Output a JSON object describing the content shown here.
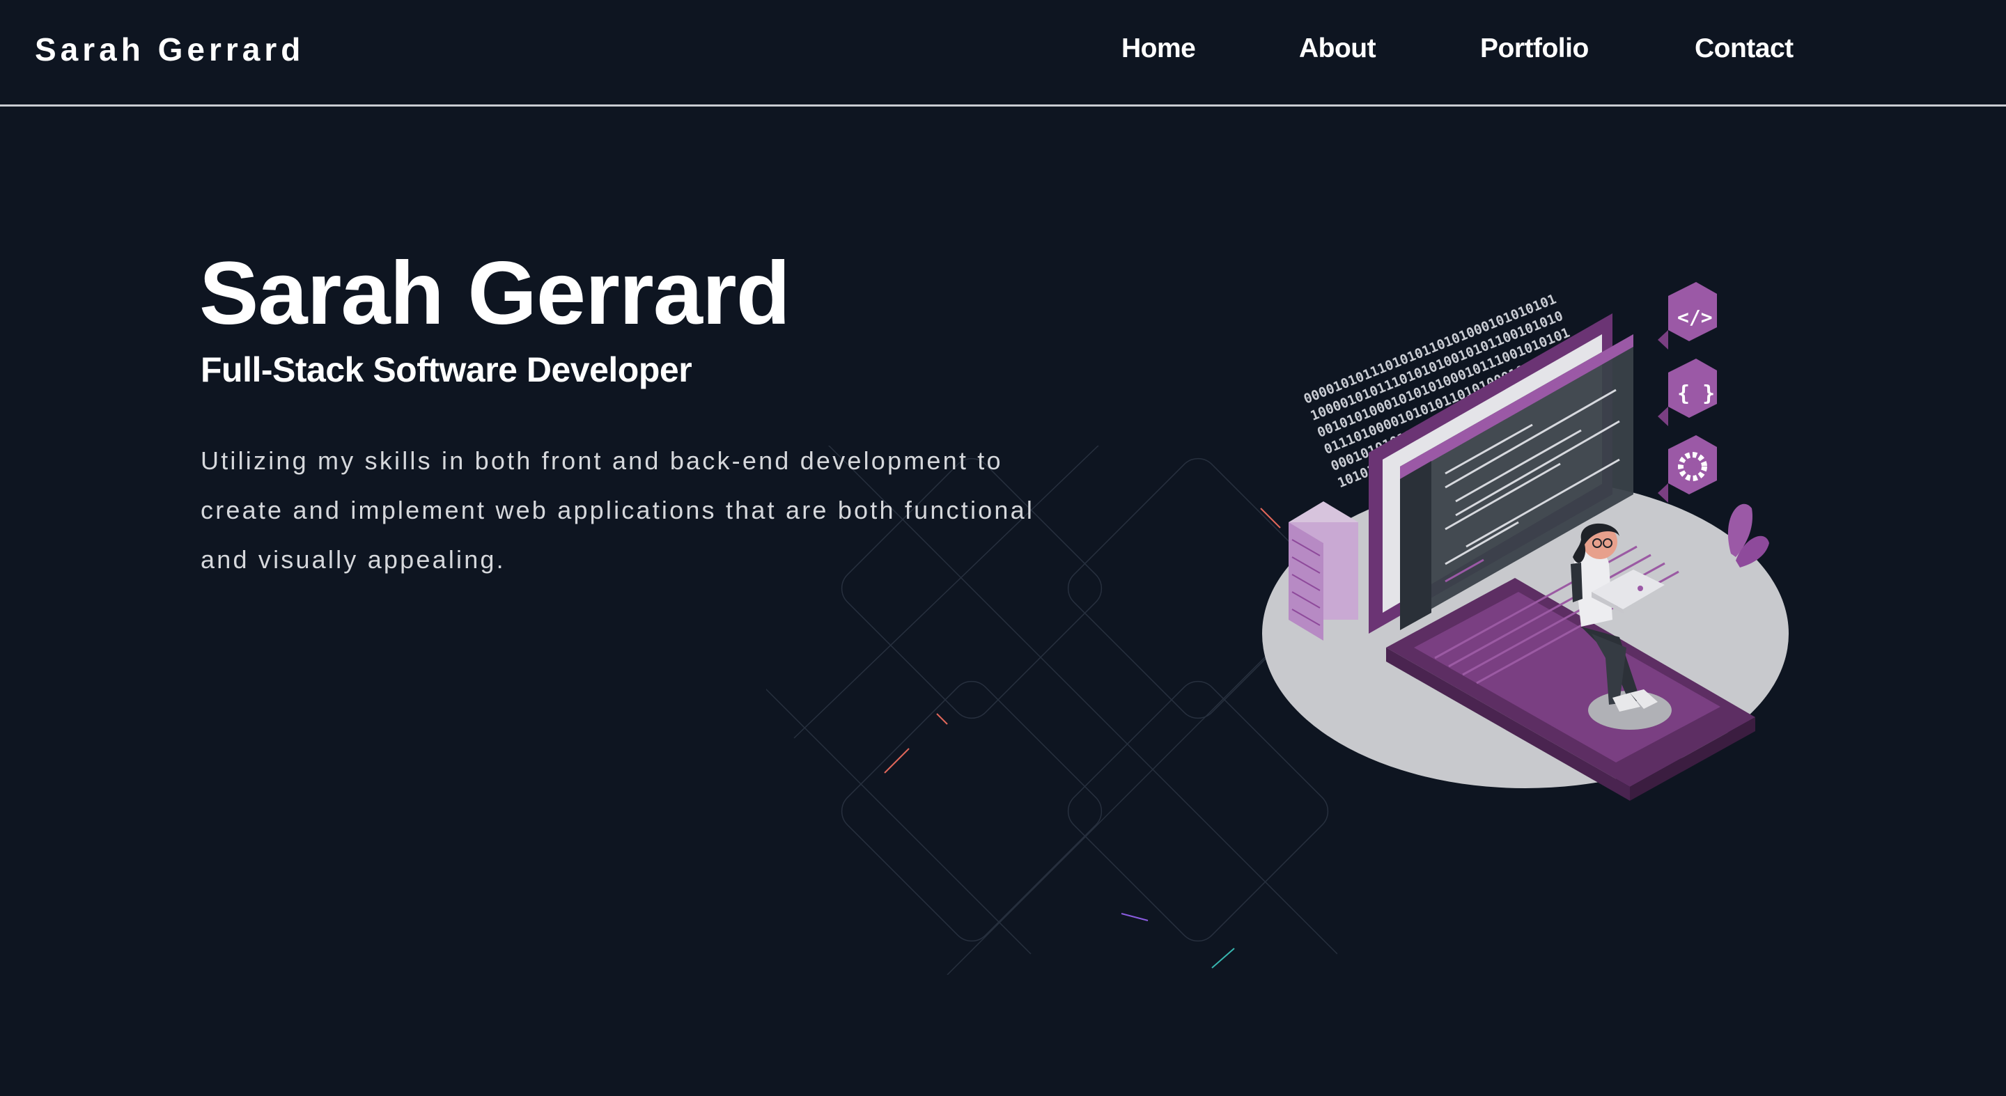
{
  "header": {
    "brand": "Sarah Gerrard",
    "nav": [
      {
        "label": "Home"
      },
      {
        "label": "About"
      },
      {
        "label": "Portfolio"
      },
      {
        "label": "Contact"
      }
    ]
  },
  "hero": {
    "title": "Sarah Gerrard",
    "subtitle": "Full-Stack Software Developer",
    "description": "Utilizing my skills in both front and back-end development to create and implement web applications that are both functional and visually appealing."
  },
  "illustration": {
    "binary_lines": [
      "0000101011101010110101000101010101",
      "1000010101110101010010101100101010",
      "0010101000101010100010111001010101",
      "0111010000101010110101000101010101",
      "0001010101101010100010101010010101",
      "1010101000101010101101010101001010"
    ],
    "code_icon": "</>",
    "braces_icon": "{ }",
    "gear_icon": "gear-icon"
  },
  "colors": {
    "background": "#0e1521",
    "text": "#ffffff",
    "muted_text": "#d6d8dc",
    "accent_purple": "#8e4a9b",
    "nav_border": "#c9ccd2"
  }
}
